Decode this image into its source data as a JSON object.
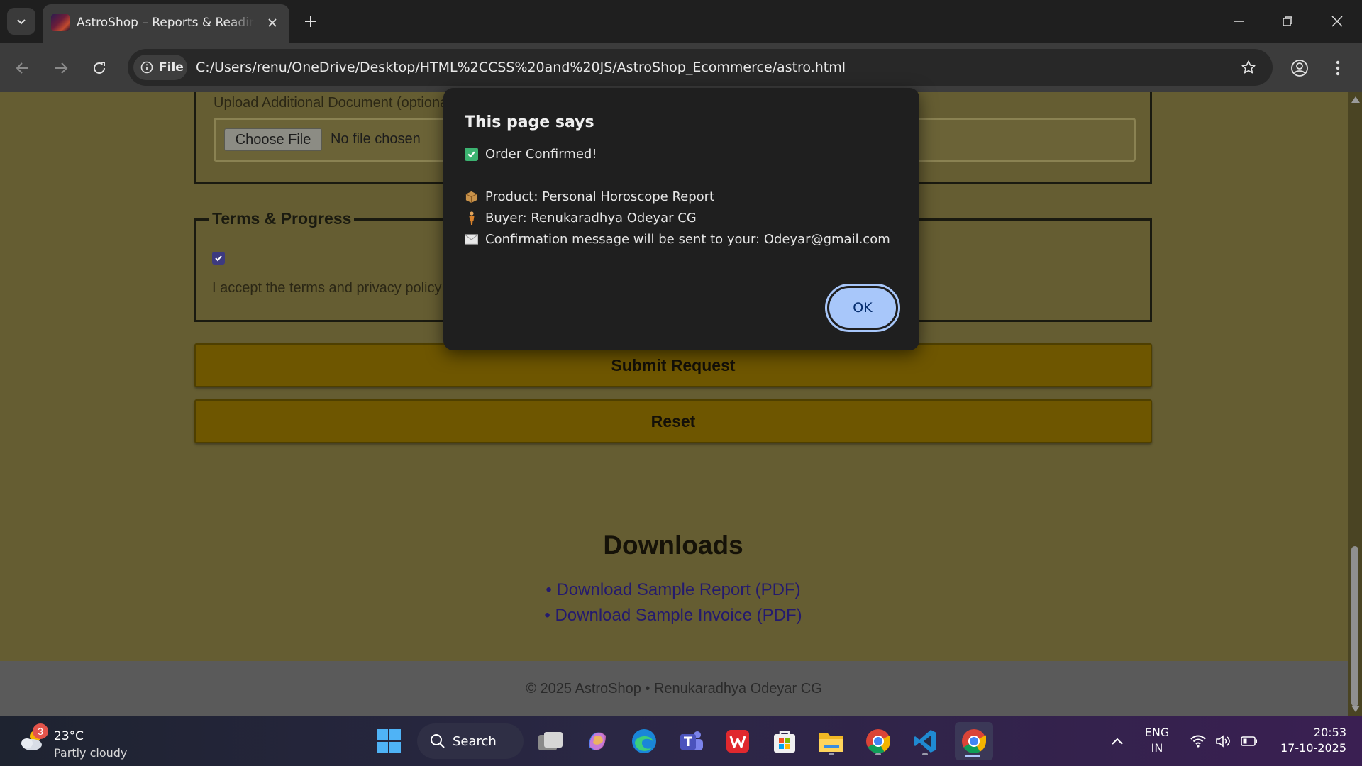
{
  "browser": {
    "tab_title": "AstroShop – Reports & Readings",
    "site_chip": "File",
    "url": "C:/Users/renu/OneDrive/Desktop/HTML%2CCSS%20and%20JS/AstroShop_Ecommerce/astro.html"
  },
  "page": {
    "upload_label": "Upload Additional Document (optional)",
    "choose_file": "Choose File",
    "no_file": "No file chosen",
    "terms_legend": "Terms & Progress",
    "terms_text": "I accept the terms and privacy policy",
    "terms_checked": true,
    "submit": "Submit Request",
    "reset": "Reset",
    "downloads_title": "Downloads",
    "link_report": "• Download Sample Report (PDF)",
    "link_invoice": "• Download Sample Invoice (PDF)",
    "footer": "© 2025 AstroShop • Renukaradhya Odeyar CG"
  },
  "dialog": {
    "title": "This page says",
    "line_confirmed": "Order Confirmed!",
    "line_product": "Product: Personal Horoscope Report",
    "line_buyer": "Buyer: Renukaradhya Odeyar CG",
    "line_email": "Confirmation message will be sent to your: Odeyar@gmail.com",
    "ok": "OK"
  },
  "taskbar": {
    "weather_badge": "3",
    "temperature": "23°C",
    "condition": "Partly cloudy",
    "search": "Search",
    "lang_1": "ENG",
    "lang_2": "IN",
    "time": "20:53",
    "date": "17-10-2025"
  },
  "colors": {
    "page_bg": "#655d32",
    "button_bg": "#6e5600",
    "dialog_bg": "#1f1f1f",
    "ok_button": "#a8c7fa",
    "link": "#241a6e"
  }
}
